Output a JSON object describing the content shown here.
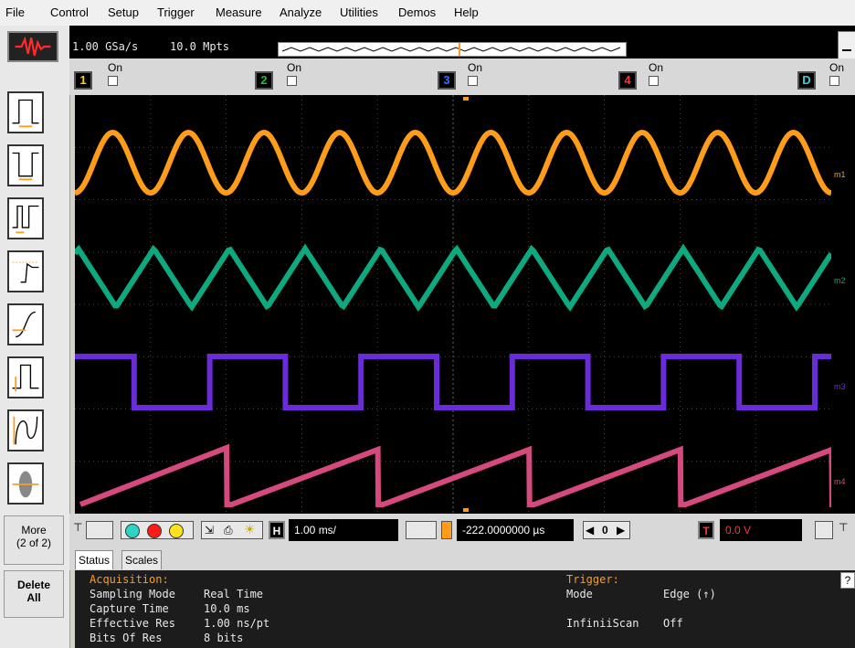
{
  "menu": [
    "File",
    "Control",
    "Setup",
    "Trigger",
    "Measure",
    "Analyze",
    "Utilities",
    "Demos",
    "Help"
  ],
  "acquisition": {
    "sample_rate": "1.00 GSa/s",
    "memory_depth": "10.0 Mpts"
  },
  "channels": [
    {
      "label": "1",
      "on_label": "On",
      "color": "#ffd400"
    },
    {
      "label": "2",
      "on_label": "On",
      "color": "#19c22e"
    },
    {
      "label": "3",
      "on_label": "On",
      "color": "#3a6cff"
    },
    {
      "label": "4",
      "on_label": "On",
      "color": "#ff3535"
    },
    {
      "label": "D",
      "on_label": "On",
      "color": "#2fd3e0"
    }
  ],
  "waveform_markers": [
    "m1",
    "m2",
    "m3",
    "m4"
  ],
  "trace_colors": {
    "m1": "#ff9c1a",
    "m2": "#0fa97f",
    "m3": "#6a2bd8",
    "m4": "#d6497e"
  },
  "side_buttons": {
    "more_label": "More",
    "more_page": "(2 of 2)",
    "delete_label": "Delete",
    "delete_label2": "All"
  },
  "horizontal": {
    "scale_prefix": "H",
    "scale": "1.00 ms/",
    "delay": "-222.0000000 µs",
    "center_value": "0"
  },
  "trigger": {
    "prefix": "T",
    "level": "0.0 V"
  },
  "tabs": [
    "Status",
    "Scales"
  ],
  "status": {
    "acquisition_header": "Acquisition:",
    "rows": [
      {
        "key": "Sampling Mode",
        "value": "Real Time"
      },
      {
        "key": "Capture Time",
        "value": "10.0 ms"
      },
      {
        "key": "Effective Res",
        "value": "1.00 ns/pt"
      },
      {
        "key": "Bits Of Res",
        "value": "8 bits"
      }
    ],
    "trigger_header": "Trigger:",
    "trigger_rows": [
      {
        "key": "Mode",
        "value": "Edge (↑)"
      },
      {
        "key": "InfiniiScan",
        "value": "Off"
      }
    ],
    "help_label": "?"
  },
  "colors": {
    "orange_text": "#ff9c1a",
    "scope_bg": "#000000",
    "grid": "#555555"
  }
}
